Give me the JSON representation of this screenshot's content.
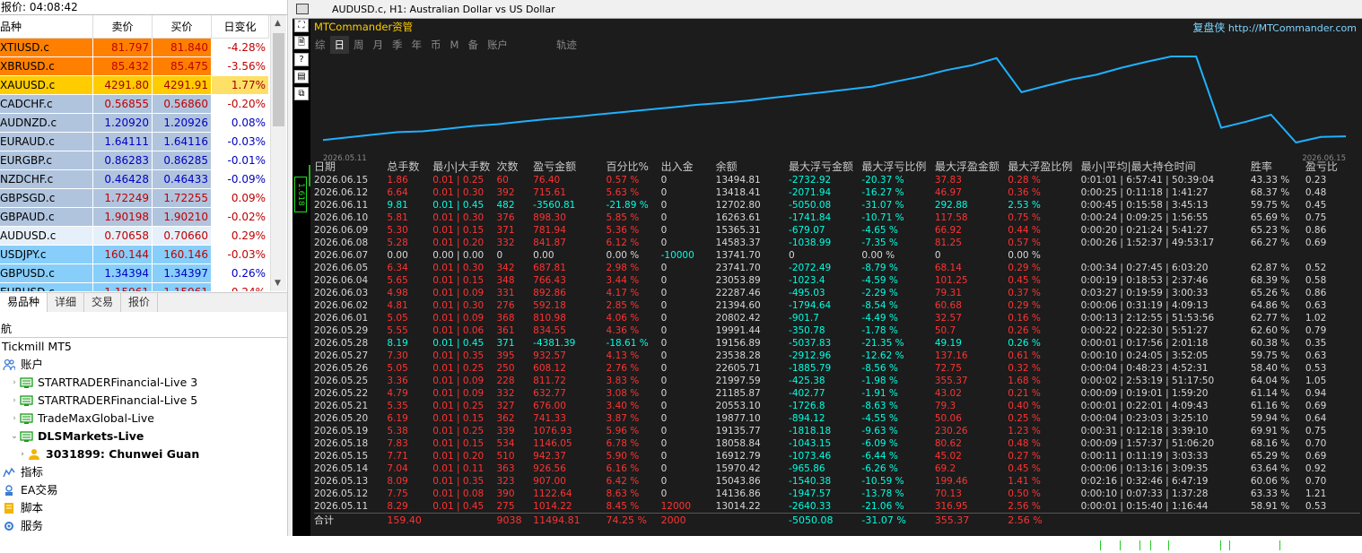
{
  "market_watch": {
    "title": "报价: 04:08:42",
    "headers": [
      "品种",
      "卖价",
      "买价",
      "日变化"
    ],
    "rows": [
      {
        "symbol": "XTIUSD.c",
        "bid": "81.797",
        "ask": "81.840",
        "change": "-4.28%",
        "bg": "#ff8000",
        "fg": "#c00000"
      },
      {
        "symbol": "XBRUSD.c",
        "bid": "85.432",
        "ask": "85.475",
        "change": "-3.56%",
        "bg": "#ff8000",
        "fg": "#c00000"
      },
      {
        "symbol": "XAUUSD.c",
        "bid": "4291.80",
        "ask": "4291.91",
        "change": "1.77%",
        "bg": "#ffcc00",
        "fg": "#a00000"
      },
      {
        "symbol": "CADCHF.c",
        "bid": "0.56855",
        "ask": "0.56860",
        "change": "-0.20%",
        "bg": "#b0c4de",
        "fg": "#c00000"
      },
      {
        "symbol": "AUDNZD.c",
        "bid": "1.20920",
        "ask": "1.20926",
        "change": "0.08%",
        "bg": "#b0c4de",
        "fg": "#0000c0"
      },
      {
        "symbol": "EURAUD.c",
        "bid": "1.64111",
        "ask": "1.64116",
        "change": "-0.03%",
        "bg": "#b0c4de",
        "fg": "#0000c0"
      },
      {
        "symbol": "EURGBP.c",
        "bid": "0.86283",
        "ask": "0.86285",
        "change": "-0.01%",
        "bg": "#b0c4de",
        "fg": "#0000c0"
      },
      {
        "symbol": "NZDCHF.c",
        "bid": "0.46428",
        "ask": "0.46433",
        "change": "-0.09%",
        "bg": "#b0c4de",
        "fg": "#0000c0"
      },
      {
        "symbol": "GBPSGD.c",
        "bid": "1.72249",
        "ask": "1.72255",
        "change": "0.09%",
        "bg": "#b0c4de",
        "fg": "#c00000"
      },
      {
        "symbol": "GBPAUD.c",
        "bid": "1.90198",
        "ask": "1.90210",
        "change": "-0.02%",
        "bg": "#b0c4de",
        "fg": "#c00000"
      },
      {
        "symbol": "AUDUSD.c",
        "bid": "0.70658",
        "ask": "0.70660",
        "change": "0.29%",
        "bg": "#e6f0fa",
        "fg": "#c00000"
      },
      {
        "symbol": "USDJPY.c",
        "bid": "160.144",
        "ask": "160.146",
        "change": "-0.03%",
        "bg": "#87cefa",
        "fg": "#c00000"
      },
      {
        "symbol": "GBPUSD.c",
        "bid": "1.34394",
        "ask": "1.34397",
        "change": "0.26%",
        "bg": "#87cefa",
        "fg": "#0000c0"
      },
      {
        "symbol": "EURUSD.c",
        "bid": "1.15961",
        "ask": "1.15961",
        "change": "0.24%",
        "bg": "#87cefa",
        "fg": "#c00000"
      }
    ],
    "tabs": [
      "易品种",
      "详细",
      "交易",
      "报价"
    ]
  },
  "navigator": {
    "title": "航",
    "items": [
      {
        "label": "Tickmill MT5",
        "indent": 0,
        "bold": false,
        "icon": "none",
        "exp": ""
      },
      {
        "label": "账户",
        "indent": 0,
        "bold": false,
        "icon": "people",
        "exp": ""
      },
      {
        "label": "STARTRADERFinancial-Live 3",
        "indent": 1,
        "bold": false,
        "icon": "server",
        "exp": "›"
      },
      {
        "label": "STARTRADERFinancial-Live 5",
        "indent": 1,
        "bold": false,
        "icon": "server",
        "exp": "›"
      },
      {
        "label": "TradeMaxGlobal-Live",
        "indent": 1,
        "bold": false,
        "icon": "server",
        "exp": "›"
      },
      {
        "label": "DLSMarkets-Live",
        "indent": 1,
        "bold": true,
        "icon": "server",
        "exp": "⌄"
      },
      {
        "label": "3031899: Chunwei Guan",
        "indent": 2,
        "bold": true,
        "icon": "user",
        "exp": "›"
      },
      {
        "label": "指标",
        "indent": 0,
        "bold": false,
        "icon": "indicator",
        "exp": ""
      },
      {
        "label": "EA交易",
        "indent": 0,
        "bold": false,
        "icon": "ea",
        "exp": ""
      },
      {
        "label": "脚本",
        "indent": 0,
        "bold": false,
        "icon": "script",
        "exp": ""
      },
      {
        "label": "服务",
        "indent": 0,
        "bold": false,
        "icon": "service",
        "exp": ""
      }
    ]
  },
  "chart_window": {
    "title": "AUDUSD.c, H1:  Australian Dollar vs US Dollar",
    "toolbar_icons": [
      "move-icon",
      "chart-icon",
      "help-icon",
      "list-icon",
      "window-icon"
    ],
    "toolbar_glyphs": [
      "⛶",
      "🗎",
      "?",
      "▤",
      "⧉"
    ],
    "price_label": "1.618",
    "brand": "MTCommander资管",
    "credit_cn": "复盘侠",
    "credit_url": "http://MTCommander.com",
    "period_tabs": [
      "综",
      "日",
      "周",
      "月",
      "季",
      "年",
      "币",
      "M",
      "备",
      "账户",
      "",
      "轨迹"
    ],
    "active_tab": 1
  },
  "chart_data": {
    "type": "line",
    "x_start_label": "2026.05.11",
    "x_end_label": "2026.06.15",
    "series_color": "#1fb1ff",
    "y": [
      13014.22,
      13356,
      13698,
      14040,
      14136.86,
      14474,
      14814,
      15043.86,
      15394,
      15706,
      15970.42,
      16290,
      16600,
      16912.79,
      17226,
      17540,
      17776,
      18058.84,
      18436,
      18790,
      19135.77,
      19500,
      19877.1,
      20553.1,
      21185.87,
      21997.59,
      22605.71,
      23538.28,
      19156.89,
      19991.44,
      20802.42,
      21394.6,
      22287.46,
      23053.89,
      23741.7,
      23741.7,
      14583.37,
      15365.31,
      16263.61,
      12702.8,
      13418.41,
      13494.81
    ]
  },
  "stats": {
    "headers": [
      "日期",
      "总手数",
      "最小|大手数",
      "次数",
      "盈亏金额",
      "百分比%",
      "出入金",
      "余额",
      "最大浮亏金额",
      "最大浮亏比例",
      "最大浮盈金额",
      "最大浮盈比例",
      "最小|平均|最大持仓时间",
      "",
      "胜率",
      "盈亏比"
    ],
    "rows": [
      [
        "2026.06.15",
        "1.86",
        "0.01 | 0.25",
        "60",
        "76.40",
        "0.57 %",
        "0",
        "13494.81",
        "-2732.92",
        "-20.37 %",
        "37.83",
        "0.28 %",
        "0:01:01 | 6:57:41 | 50:39:04",
        "",
        "43.33 %",
        "0.23",
        "r"
      ],
      [
        "2026.06.12",
        "6.64",
        "0.01 | 0.30",
        "392",
        "715.61",
        "5.63 %",
        "0",
        "13418.41",
        "-2071.94",
        "-16.27 %",
        "46.97",
        "0.36 %",
        "0:00:25 | 0:11:18 | 1:41:27",
        "",
        "68.37 %",
        "0.48",
        "r"
      ],
      [
        "2026.06.11",
        "9.81",
        "0.01 | 0.45",
        "482",
        "-3560.81",
        "-21.89 %",
        "0",
        "12702.80",
        "-5050.08",
        "-31.07 %",
        "292.88",
        "2.53 %",
        "0:00:45 | 0:15:58 | 3:45:13",
        "",
        "59.75 %",
        "0.45",
        "c"
      ],
      [
        "2026.06.10",
        "5.81",
        "0.01 | 0.30",
        "376",
        "898.30",
        "5.85 %",
        "0",
        "16263.61",
        "-1741.84",
        "-10.71 %",
        "117.58",
        "0.75 %",
        "0:00:24 | 0:09:25 | 1:56:55",
        "",
        "65.69 %",
        "0.75",
        "r"
      ],
      [
        "2026.06.09",
        "5.30",
        "0.01 | 0.15",
        "371",
        "781.94",
        "5.36 %",
        "0",
        "15365.31",
        "-679.07",
        "-4.65 %",
        "66.92",
        "0.44 %",
        "0:00:20 | 0:21:24 | 5:41:27",
        "",
        "65.23 %",
        "0.86",
        "r"
      ],
      [
        "2026.06.08",
        "5.28",
        "0.01 | 0.20",
        "332",
        "841.87",
        "6.12 %",
        "0",
        "14583.37",
        "-1038.99",
        "-7.35 %",
        "81.25",
        "0.57 %",
        "0:00:26 | 1:52:37 | 49:53:17",
        "",
        "66.27 %",
        "0.69",
        "r"
      ],
      [
        "2026.06.07",
        "0.00",
        "0.00 | 0.00",
        "0",
        "0.00",
        "0.00 %",
        "-10000",
        "13741.70",
        "0",
        "0.00 %",
        "0",
        "0.00 %",
        "",
        "",
        "",
        "",
        "w"
      ],
      [
        "2026.06.05",
        "6.34",
        "0.01 | 0.30",
        "342",
        "687.81",
        "2.98 %",
        "0",
        "23741.70",
        "-2072.49",
        "-8.79 %",
        "68.14",
        "0.29 %",
        "0:00:34 | 0:27:45 | 6:03:20",
        "",
        "62.87 %",
        "0.52",
        "r"
      ],
      [
        "2026.06.04",
        "5.65",
        "0.01 | 0.15",
        "348",
        "766.43",
        "3.44 %",
        "0",
        "23053.89",
        "-1023.4",
        "-4.59 %",
        "101.25",
        "0.45 %",
        "0:00:19 | 0:18:53 | 2:37:46",
        "",
        "68.39 %",
        "0.58",
        "r"
      ],
      [
        "2026.06.03",
        "4.98",
        "0.01 | 0.09",
        "331",
        "892.86",
        "4.17 %",
        "0",
        "22287.46",
        "-495.03",
        "-2.29 %",
        "79.31",
        "0.37 %",
        "0:03:27 | 0:19:59 | 3:00:33",
        "",
        "65.26 %",
        "0.86",
        "r"
      ],
      [
        "2026.06.02",
        "4.81",
        "0.01 | 0.30",
        "276",
        "592.18",
        "2.85 %",
        "0",
        "21394.60",
        "-1794.64",
        "-8.54 %",
        "60.68",
        "0.29 %",
        "0:00:06 | 0:31:19 | 4:09:13",
        "",
        "64.86 %",
        "0.63",
        "r"
      ],
      [
        "2026.06.01",
        "5.05",
        "0.01 | 0.09",
        "368",
        "810.98",
        "4.06 %",
        "0",
        "20802.42",
        "-901.7",
        "-4.49 %",
        "32.57",
        "0.16 %",
        "0:00:13 | 2:12:55 | 51:53:56",
        "",
        "62.77 %",
        "1.02",
        "r"
      ],
      [
        "2026.05.29",
        "5.55",
        "0.01 | 0.06",
        "361",
        "834.55",
        "4.36 %",
        "0",
        "19991.44",
        "-350.78",
        "-1.78 %",
        "50.7",
        "0.26 %",
        "0:00:22 | 0:22:30 | 5:51:27",
        "",
        "62.60 %",
        "0.79",
        "r"
      ],
      [
        "2026.05.28",
        "8.19",
        "0.01 | 0.45",
        "371",
        "-4381.39",
        "-18.61 %",
        "0",
        "19156.89",
        "-5037.83",
        "-21.35 %",
        "49.19",
        "0.26 %",
        "0:00:01 | 0:17:56 | 2:01:18",
        "",
        "60.38 %",
        "0.35",
        "c"
      ],
      [
        "2026.05.27",
        "7.30",
        "0.01 | 0.35",
        "395",
        "932.57",
        "4.13 %",
        "0",
        "23538.28",
        "-2912.96",
        "-12.62 %",
        "137.16",
        "0.61 %",
        "0:00:10 | 0:24:05 | 3:52:05",
        "",
        "59.75 %",
        "0.63",
        "r"
      ],
      [
        "2026.05.26",
        "5.05",
        "0.01 | 0.25",
        "250",
        "608.12",
        "2.76 %",
        "0",
        "22605.71",
        "-1885.79",
        "-8.56 %",
        "72.75",
        "0.32 %",
        "0:00:04 | 0:48:23 | 4:52:31",
        "",
        "58.40 %",
        "0.53",
        "r"
      ],
      [
        "2026.05.25",
        "3.36",
        "0.01 | 0.09",
        "228",
        "811.72",
        "3.83 %",
        "0",
        "21997.59",
        "-425.38",
        "-1.98 %",
        "355.37",
        "1.68 %",
        "0:00:02 | 2:53:19 | 51:17:50",
        "",
        "64.04 %",
        "1.05",
        "r"
      ],
      [
        "2026.05.22",
        "4.79",
        "0.01 | 0.09",
        "332",
        "632.77",
        "3.08 %",
        "0",
        "21185.87",
        "-402.77",
        "-1.91 %",
        "43.02",
        "0.21 %",
        "0:00:09 | 0:19:01 | 1:59:20",
        "",
        "61.14 %",
        "0.94",
        "r"
      ],
      [
        "2026.05.21",
        "5.35",
        "0.01 | 0.25",
        "327",
        "676.00",
        "3.40 %",
        "0",
        "20553.10",
        "-1726.8",
        "-8.63 %",
        "79.3",
        "0.40 %",
        "0:00:01 | 0:22:01 | 4:09:43",
        "",
        "61.16 %",
        "0.69",
        "r"
      ],
      [
        "2026.05.20",
        "6.19",
        "0.01 | 0.15",
        "362",
        "741.33",
        "3.87 %",
        "0",
        "19877.10",
        "-894.12",
        "-4.55 %",
        "50.06",
        "0.25 %",
        "0:00:04 | 0:23:03 | 3:25:10",
        "",
        "59.94 %",
        "0.64",
        "r"
      ],
      [
        "2026.05.19",
        "5.38",
        "0.01 | 0.25",
        "339",
        "1076.93",
        "5.96 %",
        "0",
        "19135.77",
        "-1818.18",
        "-9.63 %",
        "230.26",
        "1.23 %",
        "0:00:31 | 0:12:18 | 3:39:10",
        "",
        "69.91 %",
        "0.75",
        "r"
      ],
      [
        "2026.05.18",
        "7.83",
        "0.01 | 0.15",
        "534",
        "1146.05",
        "6.78 %",
        "0",
        "18058.84",
        "-1043.15",
        "-6.09 %",
        "80.62",
        "0.48 %",
        "0:00:09 | 1:57:37 | 51:06:20",
        "",
        "68.16 %",
        "0.70",
        "r"
      ],
      [
        "2026.05.15",
        "7.71",
        "0.01 | 0.20",
        "510",
        "942.37",
        "5.90 %",
        "0",
        "16912.79",
        "-1073.46",
        "-6.44 %",
        "45.02",
        "0.27 %",
        "0:00:11 | 0:11:19 | 3:03:33",
        "",
        "65.29 %",
        "0.69",
        "r"
      ],
      [
        "2026.05.14",
        "7.04",
        "0.01 | 0.11",
        "363",
        "926.56",
        "6.16 %",
        "0",
        "15970.42",
        "-965.86",
        "-6.26 %",
        "69.2",
        "0.45 %",
        "0:00:06 | 0:13:16 | 3:09:35",
        "",
        "63.64 %",
        "0.92",
        "r"
      ],
      [
        "2026.05.13",
        "8.09",
        "0.01 | 0.35",
        "323",
        "907.00",
        "6.42 %",
        "0",
        "15043.86",
        "-1540.38",
        "-10.59 %",
        "199.46",
        "1.41 %",
        "0:02:16 | 0:32:46 | 6:47:19",
        "",
        "60.06 %",
        "0.70",
        "r"
      ],
      [
        "2026.05.12",
        "7.75",
        "0.01 | 0.08",
        "390",
        "1122.64",
        "8.63 %",
        "0",
        "14136.86",
        "-1947.57",
        "-13.78 %",
        "70.13",
        "0.50 %",
        "0:00:10 | 0:07:33 | 1:37:28",
        "",
        "63.33 %",
        "1.21",
        "r"
      ],
      [
        "2026.05.11",
        "8.29",
        "0.01 | 0.45",
        "275",
        "1014.22",
        "8.45 %",
        "12000",
        "13014.22",
        "-2640.33",
        "-21.06 %",
        "316.95",
        "2.56 %",
        "0:00:01 | 0:15:40 | 1:16:44",
        "",
        "58.91 %",
        "0.53",
        "r"
      ]
    ],
    "total": [
      "合计",
      "159.40",
      "",
      "9038",
      "11494.81",
      "74.25 %",
      "2000",
      "",
      "-5050.08",
      "-31.07 %",
      "355.37",
      "2.56 %",
      "",
      "",
      "",
      ""
    ]
  },
  "colors": {
    "panel_bg": "#1c1c1c",
    "red": "#ff3333",
    "cyan": "#00ffe1",
    "white": "#d8d8d8",
    "line": "#1fb1ff"
  }
}
